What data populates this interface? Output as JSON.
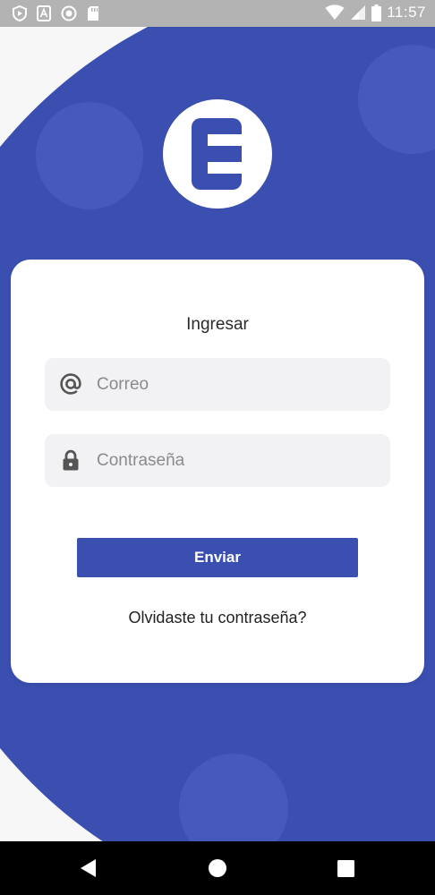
{
  "status_bar": {
    "time": "11:57",
    "icons": [
      "shield-icon",
      "android-icon",
      "circle-icon",
      "sd-card-icon",
      "wifi-icon",
      "signal-icon",
      "battery-icon"
    ]
  },
  "brand": {
    "logo_letter": "E",
    "primary_color": "#3b4fb1"
  },
  "login": {
    "title": "Ingresar",
    "email_placeholder": "Correo",
    "email_value": "",
    "password_placeholder": "Contraseña",
    "password_value": "",
    "submit_label": "Enviar",
    "forgot_label": "Olvidaste tu contraseña?"
  },
  "nav_bar": {
    "buttons": [
      "back-icon",
      "home-icon",
      "recents-icon"
    ]
  }
}
